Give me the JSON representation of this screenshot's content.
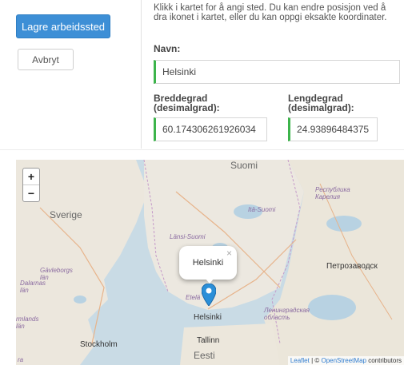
{
  "buttons": {
    "save_label": "Lagre arbeidssted",
    "cancel_label": "Avbryt"
  },
  "help_text": "Klikk i kartet for å angi sted. Du kan endre posisjon ved å dra ikonet i kartet, eller du kan oppgi eksakte koordinater.",
  "fields": {
    "name_label": "Navn:",
    "name_value": "Helsinki",
    "lat_label_line1": "Breddegrad",
    "lat_label_line2": "(desimalgrad):",
    "lat_value": "60.174306261926034",
    "lon_label_line1": "Lengdegrad",
    "lon_label_line2": "(desimalgrad):",
    "lon_value": "24.93896484375"
  },
  "map": {
    "zoom_in": "+",
    "zoom_out": "−",
    "popup_text": "Helsinki",
    "popup_close": "×",
    "places": {
      "suomi": "Suomi",
      "sverige": "Sverige",
      "ita_suomi": "Itä-Suomi",
      "lansi_suomi": "Länsi-Suomi",
      "karelia": "Республика Карелия",
      "petrozavodsk": "Петрозаводск",
      "gavleborgs": "Gävleborgs län",
      "dalarnas": "Dalarnas län",
      "stockholms": "rmlands län",
      "etela": "Etelä",
      "helsinki": "Helsinki",
      "leningrad": "Ленинградская область",
      "stockholm": "Stockholm",
      "tallinn": "Tallinn",
      "eesti": "Eesti",
      "ra": "ra"
    },
    "attribution_leaflet": "Leaflet",
    "attribution_sep": " | © ",
    "attribution_osm": "OpenStreetMap",
    "attribution_rest": " contributors"
  }
}
